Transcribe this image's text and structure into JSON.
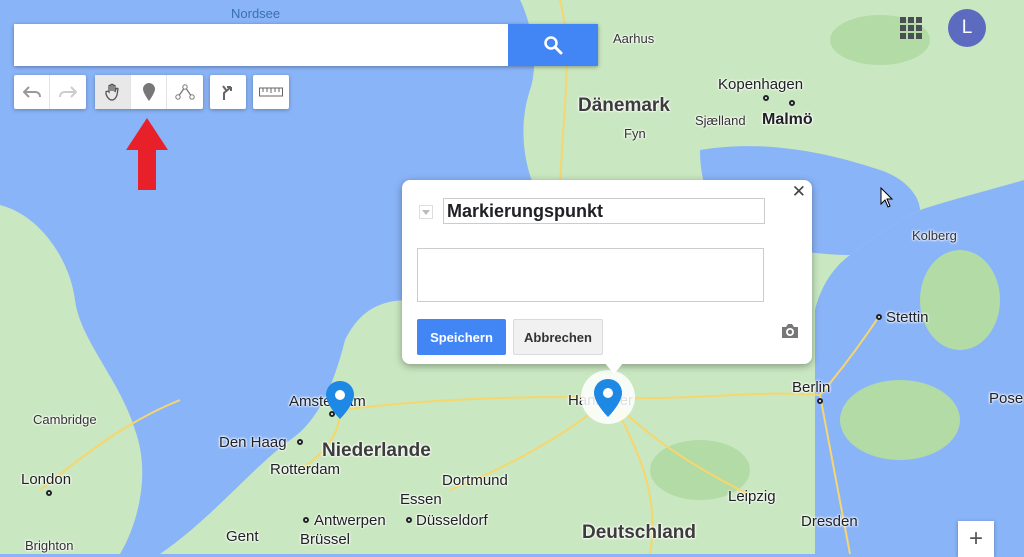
{
  "search": {
    "value": "",
    "placeholder": ""
  },
  "toolbar": {
    "undo": "undo-icon",
    "redo": "redo-icon",
    "pan": "hand-icon",
    "marker": "marker-icon",
    "line": "polyline-icon",
    "route": "route-icon",
    "measure": "ruler-icon"
  },
  "account": {
    "initial": "L"
  },
  "popup": {
    "title_value": "Markierungspunkt",
    "description_value": "",
    "save_label": "Speichern",
    "cancel_label": "Abbrechen",
    "close_label": "✕"
  },
  "zoom": {
    "plus_label": "+"
  },
  "colors": {
    "water": "#8ab4f8",
    "land": "#c9e7c0",
    "accent": "#4285f4",
    "annotation_arrow": "#e8202a",
    "marker": "#1e88e5"
  },
  "map_labels": {
    "nordsee": "Nordsee",
    "aarhus": "Aarhus",
    "danemark": "Dänemark",
    "kopenhagen": "Kopenhagen",
    "malmo": "Malmö",
    "fyn": "Fyn",
    "sjaelland": "Sjælland",
    "kolberg": "Kolberg",
    "stettin": "Stettin",
    "berlin": "Berlin",
    "posen": "Pose",
    "amsterdam": "Amsterdam",
    "niederlande": "Niederlande",
    "den_haag": "Den Haag",
    "rotterdam": "Rotterdam",
    "cambridge": "Cambridge",
    "london": "London",
    "hannover": "Hannover",
    "dortmund": "Dortmund",
    "essen": "Essen",
    "dusseldorf": "Düsseldorf",
    "antwerpen": "Antwerpen",
    "gent": "Gent",
    "brussel": "Brüssel",
    "brighton": "Brighton",
    "leipzig": "Leipzig",
    "dresden": "Dresden",
    "deutschland": "Deutschland"
  }
}
